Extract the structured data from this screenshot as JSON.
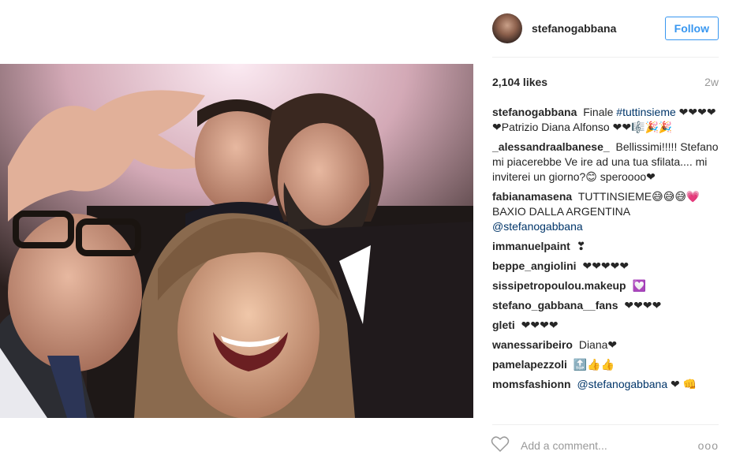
{
  "photo": {
    "alt": ""
  },
  "header": {
    "username": "stefanogabbana",
    "follow_label": "Follow"
  },
  "stats": {
    "likes": "2,104 likes",
    "age": "2w"
  },
  "comments": [
    {
      "user": "stefanogabbana",
      "text": "Finale",
      "tag": "#tuttinsieme",
      "tail": "❤❤❤❤❤Patrizio Diana Alfonso ❤❤🎼🎉🎉"
    },
    {
      "user": "_alessandraalbanese_",
      "text": "Bellissimi!!!!! Stefano mi piacerebbe Ve ire ad una tua sfilata.... mi inviterei un giorno?😊 speroooo❤"
    },
    {
      "user": "fabianamasena",
      "text": "TUTTINSIEME😅😅😅💗 BAXIO DALLA ARGENTINA",
      "tag2": "@stefanogabbana"
    },
    {
      "user": "immanuelpaint",
      "text": "❣"
    },
    {
      "user": "beppe_angiolini",
      "text": "❤❤❤❤❤"
    },
    {
      "user": "sissipetropoulou.makeup",
      "text": "💟"
    },
    {
      "user": "stefano_gabbana__fans",
      "text": "❤❤❤❤"
    },
    {
      "user": "gleti",
      "text": "❤❤❤❤"
    },
    {
      "user": "wanessaribeiro",
      "text": "Diana❤"
    },
    {
      "user": "pamelapezzoli",
      "text": "🔝👍👍"
    },
    {
      "user": "momsfashionn",
      "tag": "@stefanogabbana",
      "text": "❤ 👊"
    }
  ],
  "add_comment": {
    "placeholder": "Add a comment...",
    "more": "ooo"
  }
}
